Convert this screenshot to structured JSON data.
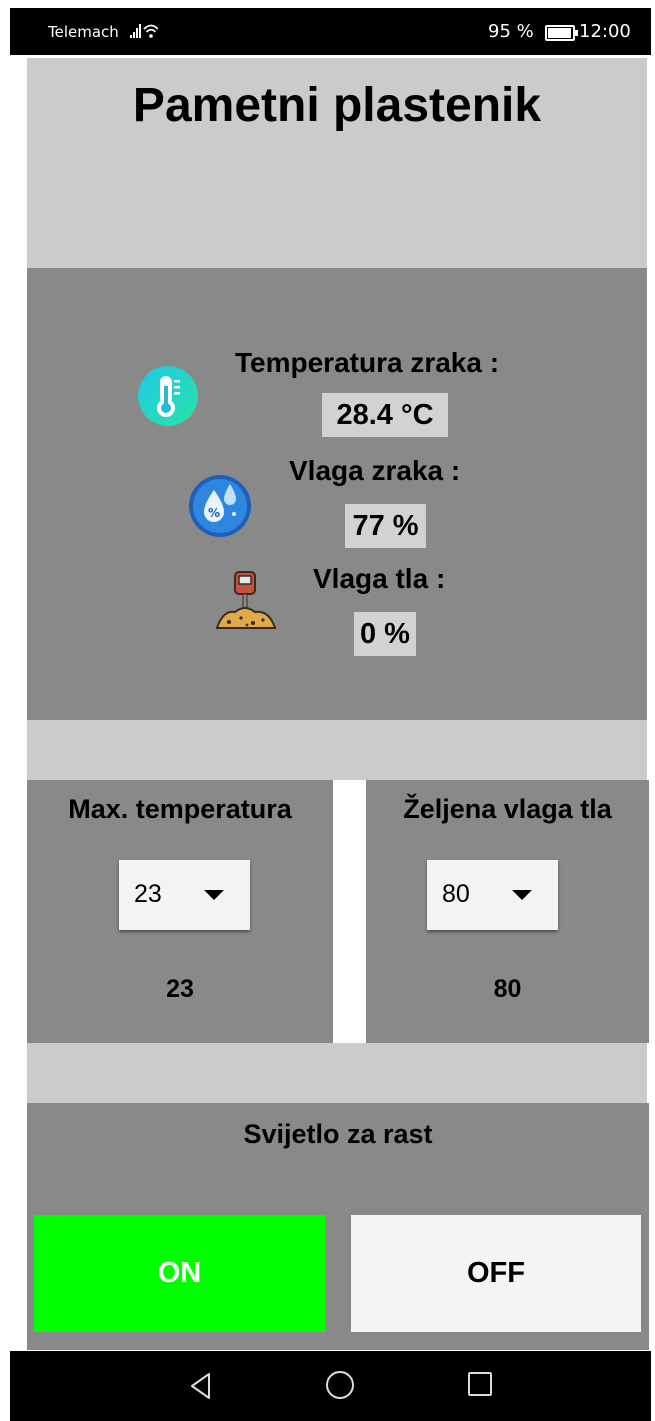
{
  "status_bar": {
    "carrier": "Telemach",
    "battery_percent": "95 %",
    "battery_level": 0.95,
    "time": "12:00"
  },
  "app": {
    "title": "Pametni plastenik"
  },
  "sensors": {
    "air_temperature": {
      "label": "Temperatura zraka :",
      "value": "28.4 °C",
      "icon": "thermometer-icon"
    },
    "air_humidity": {
      "label": "Vlaga zraka :",
      "value": "77 %",
      "icon": "humidity-drop-icon"
    },
    "soil_moisture": {
      "label": "Vlaga tla :",
      "value": "0 %",
      "icon": "soil-sensor-icon"
    }
  },
  "max_temperature": {
    "title": "Max. temperatura",
    "selected": "23",
    "display_value": "23"
  },
  "desired_soil_moisture": {
    "title": "Željena vlaga tla",
    "selected": "80",
    "display_value": "80"
  },
  "grow_light": {
    "title": "Svijetlo za rast",
    "on_label": "ON",
    "off_label": "OFF",
    "on_color": "#00ff00",
    "off_color": "#f4f4f4"
  },
  "colors": {
    "light_panel": "#cbcbcb",
    "dark_panel": "#898989",
    "value_box": "#d2d2d2"
  }
}
